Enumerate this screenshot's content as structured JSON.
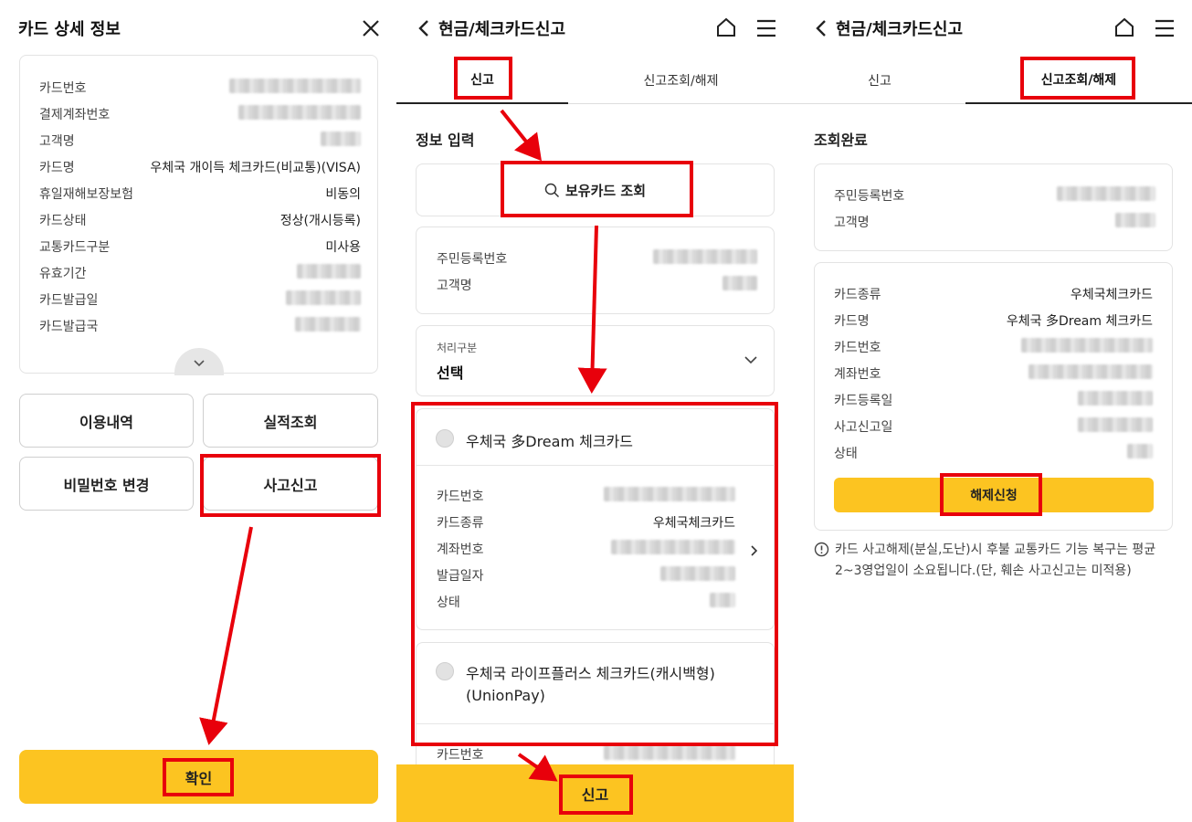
{
  "panel1": {
    "title": "카드 상세 정보",
    "rows": [
      {
        "label": "카드번호",
        "value": ""
      },
      {
        "label": "결제계좌번호",
        "value": ""
      },
      {
        "label": "고객명",
        "value": ""
      },
      {
        "label": "카드명",
        "value": "우체국 개이득 체크카드(비교통)(VISA)"
      },
      {
        "label": "휴일재해보장보험",
        "value": "비동의"
      },
      {
        "label": "카드상태",
        "value": "정상(개시등록)"
      },
      {
        "label": "교통카드구분",
        "value": "미사용"
      },
      {
        "label": "유효기간",
        "value": ""
      },
      {
        "label": "카드발급일",
        "value": ""
      },
      {
        "label": "카드발급국",
        "value": ""
      }
    ],
    "buttons": {
      "usage": "이용내역",
      "performance": "실적조회",
      "password": "비밀번호 변경",
      "report": "사고신고"
    },
    "confirm": "확인"
  },
  "panel2": {
    "title": "현금/체크카드신고",
    "tabs": [
      "신고",
      "신고조회/해제"
    ],
    "section_title": "정보 입력",
    "search_button": "보유카드 조회",
    "customer": [
      {
        "label": "주민등록번호",
        "value": ""
      },
      {
        "label": "고객명",
        "value": ""
      }
    ],
    "process": {
      "label": "처리구분",
      "value": "선택"
    },
    "card1": {
      "name": "우체국 多Dream 체크카드",
      "rows": [
        {
          "label": "카드번호",
          "value": ""
        },
        {
          "label": "카드종류",
          "value": "우체국체크카드"
        },
        {
          "label": "계좌번호",
          "value": ""
        },
        {
          "label": "발급일자",
          "value": ""
        },
        {
          "label": "상태",
          "value": ""
        }
      ]
    },
    "card2": {
      "name_line1": "우체국 라이프플러스 체크카드(캐시백형)",
      "name_line2": "(UnionPay)",
      "rows": [
        {
          "label": "카드번호",
          "value": ""
        }
      ]
    },
    "submit": "신고"
  },
  "panel3": {
    "title": "현금/체크카드신고",
    "tabs": [
      "신고",
      "신고조회/해제"
    ],
    "section_title": "조회완료",
    "customer": [
      {
        "label": "주민등록번호",
        "value": ""
      },
      {
        "label": "고객명",
        "value": ""
      }
    ],
    "rows": [
      {
        "label": "카드종류",
        "value": "우체국체크카드"
      },
      {
        "label": "카드명",
        "value": "우체국 多Dream 체크카드"
      },
      {
        "label": "카드번호",
        "value": ""
      },
      {
        "label": "계좌번호",
        "value": ""
      },
      {
        "label": "카드등록일",
        "value": ""
      },
      {
        "label": "사고신고일",
        "value": ""
      },
      {
        "label": "상태",
        "value": ""
      }
    ],
    "release_button": "해제신청",
    "notice": "카드 사고해제(분실,도난)시 후불 교통카드 기능 복구는 평균 2~3영업일이 소요됩니다.(단, 훼손 사고신고는 미적용)"
  },
  "colors": {
    "accent_yellow": "#fcc421",
    "highlight_red": "#e8000b",
    "border": "#e3e3e3"
  }
}
